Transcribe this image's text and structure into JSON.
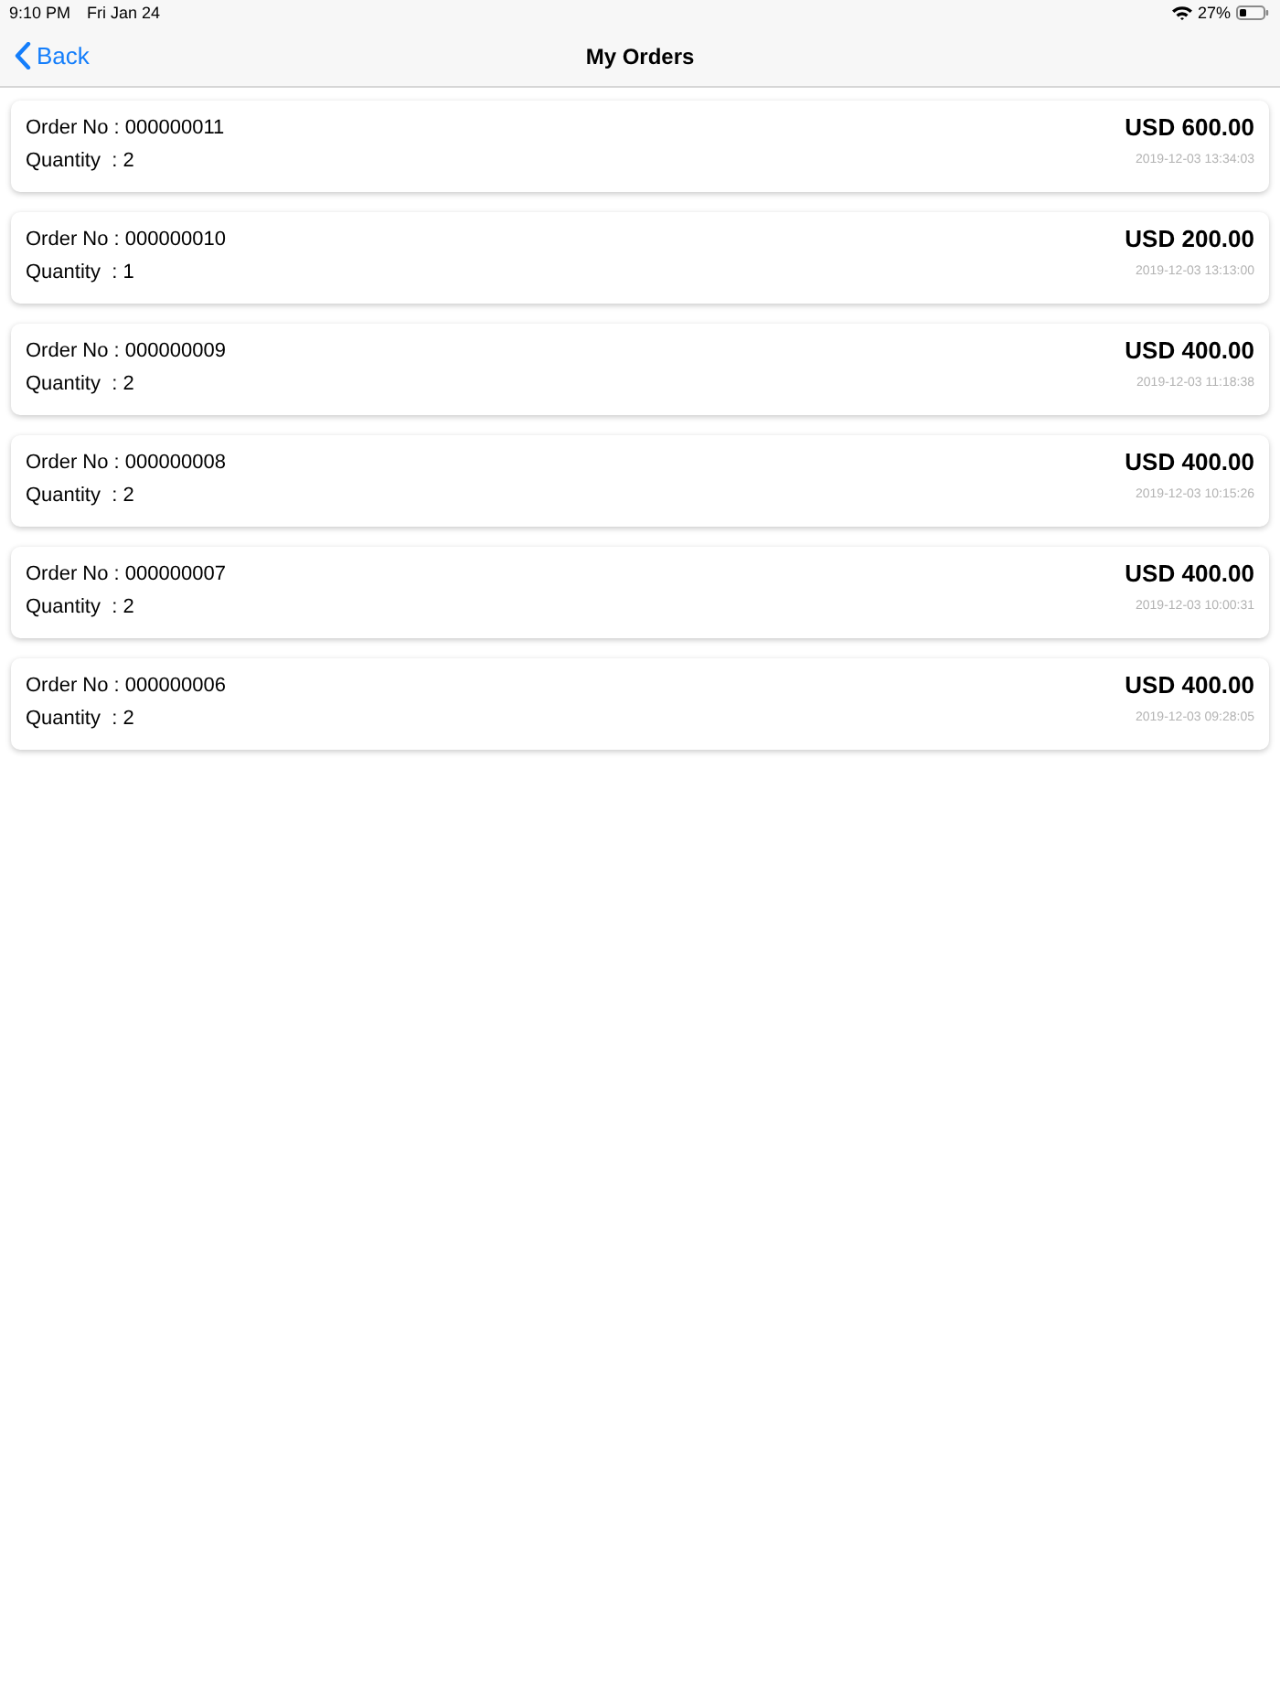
{
  "status_bar": {
    "time": "9:10 PM",
    "date": "Fri Jan 24",
    "battery": "27%"
  },
  "nav_bar": {
    "back": "Back",
    "title": "My Orders"
  },
  "orders": [
    {
      "order_no": "Order No : 000000011",
      "quantity": "Quantity  : 2",
      "amount": "USD 600.00",
      "timestamp": "2019-12-03 13:34:03"
    },
    {
      "order_no": "Order No : 000000010",
      "quantity": "Quantity  : 1",
      "amount": "USD 200.00",
      "timestamp": "2019-12-03 13:13:00"
    },
    {
      "order_no": "Order No : 000000009",
      "quantity": "Quantity  : 2",
      "amount": "USD 400.00",
      "timestamp": "2019-12-03 11:18:38"
    },
    {
      "order_no": "Order No : 000000008",
      "quantity": "Quantity  : 2",
      "amount": "USD 400.00",
      "timestamp": "2019-12-03 10:15:26"
    },
    {
      "order_no": "Order No : 000000007",
      "quantity": "Quantity  : 2",
      "amount": "USD 400.00",
      "timestamp": "2019-12-03 10:00:31"
    },
    {
      "order_no": "Order No : 000000006",
      "quantity": "Quantity  : 2",
      "amount": "USD 400.00",
      "timestamp": "2019-12-03 09:28:05"
    }
  ]
}
